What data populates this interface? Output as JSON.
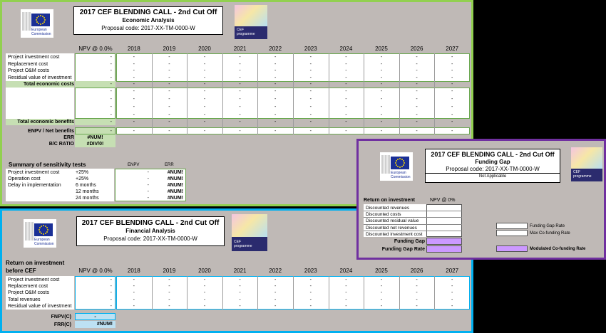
{
  "economic": {
    "title": "2017 CEF BLENDING CALL - 2nd Cut Off",
    "subtitle": "Economic Analysis",
    "code": "Proposal code: 2017-XX-TM-0000-W",
    "npv_header": "NPV @ 0.0%",
    "years": [
      "2018",
      "2019",
      "2020",
      "2021",
      "2022",
      "2023",
      "2024",
      "2025",
      "2026",
      "2027"
    ],
    "rows": [
      "Project investment cost",
      "Replacement cost",
      "Project O&M costs",
      "Residual value of investment"
    ],
    "total_costs": "Total economic costs",
    "total_benefits": "Total economic benefits",
    "enpv_label": "ENPV / Net benefits",
    "err_label": "ERR",
    "err_value": "#NUM!",
    "bc_label": "B/C RATIO",
    "bc_value": "#DIV/0!",
    "dash": "-",
    "sensitivity": {
      "title": "Summary of sensitivity tests",
      "col_enpv": "ENPV",
      "col_err": "ERR",
      "rows": [
        {
          "label": "Project investment cost",
          "param": "+25%",
          "enpv": "-",
          "err": "#NUM!"
        },
        {
          "label": "Operation cost",
          "param": "+25%",
          "enpv": "-",
          "err": "#NUM!"
        },
        {
          "label": "Delay in implementation",
          "param": "6 months",
          "enpv": "-",
          "err": "#NUM!"
        },
        {
          "label": "",
          "param": "12 months",
          "enpv": "-",
          "err": "#NUM!"
        },
        {
          "label": "",
          "param": "24 months",
          "enpv": "-",
          "err": "#NUM!"
        }
      ]
    }
  },
  "financial": {
    "title": "2017 CEF BLENDING CALL - 2nd Cut Off",
    "subtitle": "Financial Analysis",
    "code": "Proposal code: 2017-XX-TM-0000-W",
    "roi_label_1": "Return on investment",
    "roi_label_2": "before CEF",
    "npv_header": "NPV @ 0.0%",
    "years": [
      "2018",
      "2019",
      "2020",
      "2021",
      "2022",
      "2023",
      "2024",
      "2025",
      "2026",
      "2027"
    ],
    "rows": [
      "Project investment cost",
      "Replacement cost",
      "Project O&M costs",
      "Total revenues",
      "Residual value of investment"
    ],
    "fnpv_label": "FNPV(C)",
    "fnpv_value": "-",
    "frr_label": "FRR(C)",
    "frr_value": "#NUM!"
  },
  "funding": {
    "title": "2017 CEF BLENDING CALL - 2nd Cut Off",
    "subtitle": "Funding Gap",
    "code": "Proposal code: 2017-XX-TM-0000-W",
    "status": "Not Applicable",
    "roi_label": "Return on investment",
    "npv_header": "NPV @ 0%",
    "rows": [
      "Discounted  revenues",
      "Discounted costs",
      "Discounted residual value",
      "Discounted net revenues",
      "Discounted investment cost"
    ],
    "gap_label": "Funding Gap",
    "gap_rate_label": "Funding Gap Rate",
    "side_rate": "Funding Gap Rate",
    "max_cofund": "Max Co-funding Rate",
    "modulated": "Modulated Co-funding Rate"
  },
  "logos": {
    "ec_line1": "European",
    "ec_line2": "Commission",
    "cef_line1": "CEF",
    "cef_line2": "programme"
  },
  "colors": {
    "economic_border": "#92d050",
    "financial_border": "#00b0f0",
    "funding_border": "#7030a0"
  }
}
